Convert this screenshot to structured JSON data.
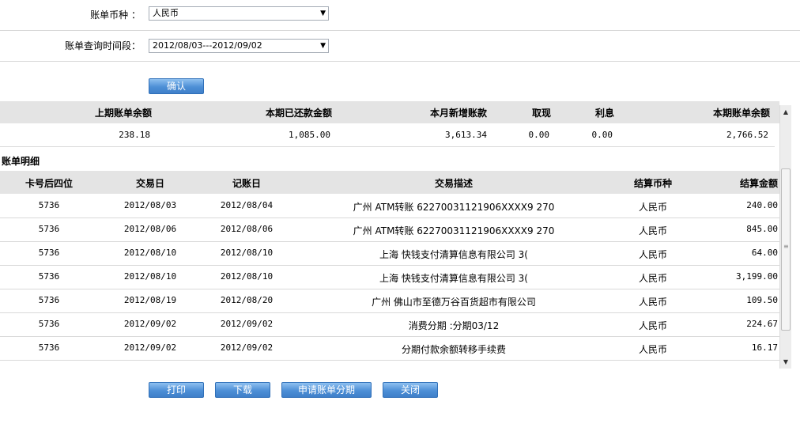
{
  "filters": {
    "currency_label": "账单币种 ：",
    "currency_value": "人民币",
    "period_label": "账单查询时间段：",
    "period_value": "2012/08/03---2012/09/02",
    "confirm_label": "确认"
  },
  "summary": {
    "headers": [
      "上期账单余额",
      "本期已还款金额",
      "本月新增账款",
      "取现",
      "利息",
      "本期账单余额"
    ],
    "values": [
      "238.18",
      "1,085.00",
      "3,613.34",
      "0.00",
      "0.00",
      "2,766.52"
    ]
  },
  "details": {
    "title": "账单明细",
    "headers": [
      "卡号后四位",
      "交易日",
      "记账日",
      "交易描述",
      "结算币种",
      "结算金额"
    ],
    "rows": [
      {
        "card": "5736",
        "trans_date": "2012/08/03",
        "post_date": "2012/08/04",
        "desc": "广州 ATM转账 62270031121906XXXX9 270",
        "currency": "人民币",
        "amount": "240.00"
      },
      {
        "card": "5736",
        "trans_date": "2012/08/06",
        "post_date": "2012/08/06",
        "desc": "广州 ATM转账 62270031121906XXXX9 270",
        "currency": "人民币",
        "amount": "845.00"
      },
      {
        "card": "5736",
        "trans_date": "2012/08/10",
        "post_date": "2012/08/10",
        "desc": "上海 快钱支付清算信息有限公司 3(",
        "currency": "人民币",
        "amount": "64.00"
      },
      {
        "card": "5736",
        "trans_date": "2012/08/10",
        "post_date": "2012/08/10",
        "desc": "上海 快钱支付清算信息有限公司 3(",
        "currency": "人民币",
        "amount": "3,199.00"
      },
      {
        "card": "5736",
        "trans_date": "2012/08/19",
        "post_date": "2012/08/20",
        "desc": "广州 佛山市至德万谷百货超市有限公司",
        "currency": "人民币",
        "amount": "109.50"
      },
      {
        "card": "5736",
        "trans_date": "2012/09/02",
        "post_date": "2012/09/02",
        "desc": "消费分期 :分期03/12",
        "currency": "人民币",
        "amount": "224.67"
      },
      {
        "card": "5736",
        "trans_date": "2012/09/02",
        "post_date": "2012/09/02",
        "desc": "分期付款余额转移手续费",
        "currency": "人民币",
        "amount": "16.17"
      }
    ]
  },
  "actions": {
    "print_label": "打印",
    "download_label": "下载",
    "installment_label": "申请账单分期",
    "close_label": "关闭"
  },
  "icons": {
    "dropdown": "chevron-down-icon",
    "scroll_up": "scroll-up-arrow-icon",
    "scroll_down": "scroll-down-arrow-icon"
  },
  "colors": {
    "button_blue": "#4d8fd6",
    "header_gray": "#e4e4e4"
  }
}
